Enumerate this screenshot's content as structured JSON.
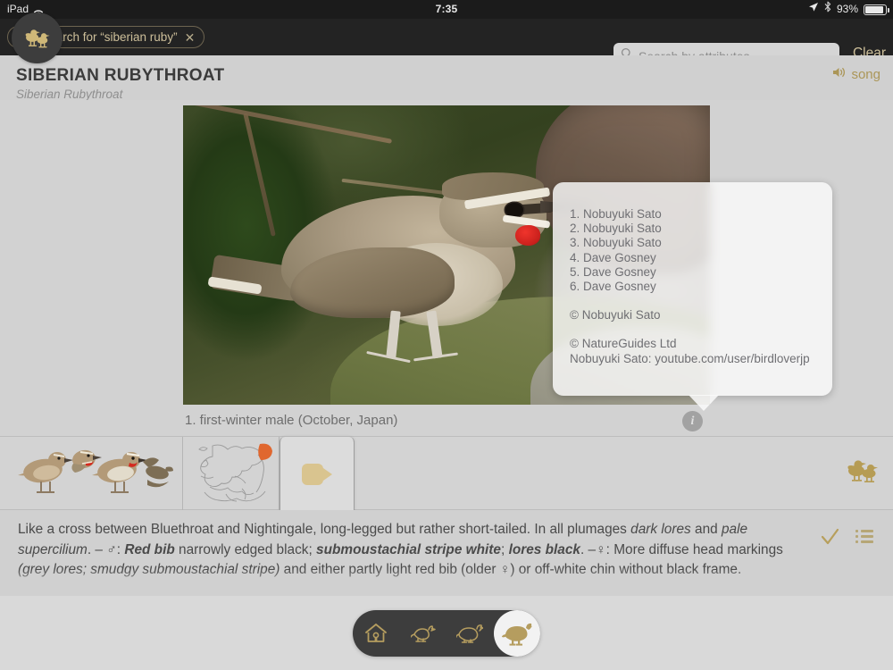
{
  "status_bar": {
    "device": "iPad",
    "wifi_icon": "wifi-icon",
    "time": "7:35",
    "location_icon": "location-arrow-icon",
    "bluetooth_icon": "bluetooth-icon",
    "battery_percent": "93%",
    "battery_icon": "battery-icon"
  },
  "search_bar": {
    "chip_label": "Text search for “siberian ruby”",
    "chip_remove_icon": "close-icon",
    "attr_search_icon": "search-icon",
    "attr_search_placeholder": "Search by attributes",
    "attr_search_value": "",
    "clear_label": "Clear"
  },
  "header": {
    "common_name": "SIBERIAN RUBYTHROAT",
    "scientific_name": "Siberian Rubythroat",
    "song_label": "song",
    "song_icon": "speaker-icon"
  },
  "media": {
    "caption": "1. first-winter male (October, Japan)",
    "info_icon": "info-icon",
    "credits": {
      "photo_credits": [
        "1. Nobuyuki Sato",
        "2. Nobuyuki Sato",
        "3. Nobuyuki Sato",
        "4. Dave Gosney",
        "5. Dave Gosney",
        "6. Dave Gosney"
      ],
      "copyright_photo": "© Nobuyuki Sato",
      "copyright_app": "© NatureGuides Ltd",
      "attribution": "Nobuyuki Sato: youtube.com/user/birdloverjp"
    }
  },
  "thumbnails": [
    {
      "name": "illustration-plates",
      "icon": "bird-plates-icon",
      "selected": false
    },
    {
      "name": "range-map",
      "icon": "map-icon",
      "selected": false
    },
    {
      "name": "video",
      "icon": "video-camera-icon",
      "selected": true
    },
    {
      "name": "more",
      "icon": "",
      "selected": false
    }
  ],
  "strip_action": {
    "icon": "two-birds-icon"
  },
  "description": {
    "line1_a": "Like a cross between Bluethroat and Nightingale, long-legged but rather short-tailed. In all plumages ",
    "line1_em1": "dark lores",
    "line1_b": " and ",
    "line1_em2": "pale supercilium",
    "line1_c": ". – ♂: ",
    "line2_em1": "Red bib",
    "line2_a": " narrowly edged black; ",
    "line2_em2": "submoustachial stripe white",
    "line2_b": "; ",
    "line2_em3": "lores black",
    "line2_c": ". –♀: More diffuse head markings ",
    "line3_em": "(grey lores; smudgy submoustachial stripe)",
    "line3_a": " and either partly light red bib (older ♀) or off-white chin without black frame.",
    "check_icon": "checkmark-icon",
    "list_icon": "list-icon"
  },
  "bottom": {
    "fab_icon": "two-birds-icon",
    "tabs": [
      {
        "name": "home",
        "icon": "home-icon",
        "active": false
      },
      {
        "name": "browse-small",
        "icon": "bird-outline-small-icon",
        "active": false
      },
      {
        "name": "browse-medium",
        "icon": "bird-outline-medium-icon",
        "active": false
      },
      {
        "name": "species",
        "icon": "bird-filled-icon",
        "active": true
      }
    ]
  },
  "colors": {
    "gold": "#b49a5c",
    "dark_bar": "#232323",
    "pane_bg": "#d0d0d0",
    "accent_red": "#d4221c",
    "range_orange": "#e06a33"
  }
}
